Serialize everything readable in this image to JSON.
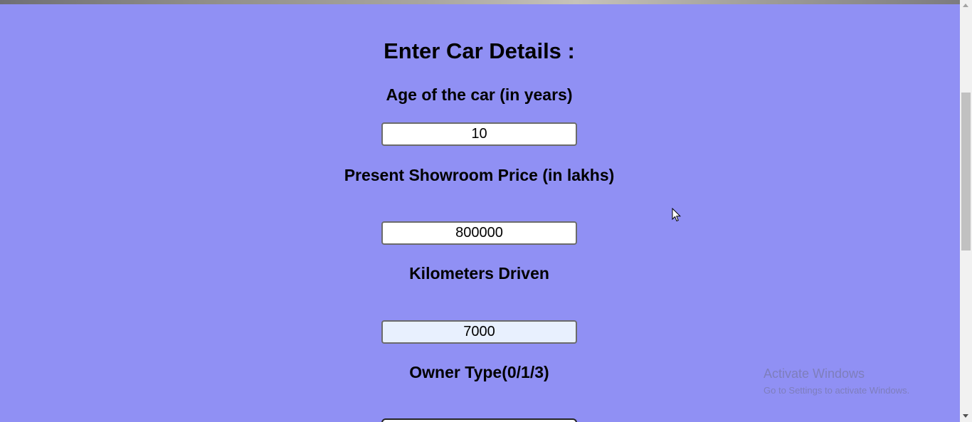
{
  "form": {
    "heading": "Enter Car Details :",
    "fields": [
      {
        "label": "Age of the car (in years)",
        "value": "10"
      },
      {
        "label": "Present Showroom Price (in lakhs)",
        "value": "800000"
      },
      {
        "label": "Kilometers Driven",
        "value": "7000"
      },
      {
        "label": "Owner Type(0/1/3)",
        "value": ""
      }
    ]
  },
  "watermark": {
    "title": "Activate Windows",
    "subtitle": "Go to Settings to activate Windows."
  },
  "colors": {
    "page_background": "#9090f4",
    "focused_field_background": "#e8f0fe"
  }
}
